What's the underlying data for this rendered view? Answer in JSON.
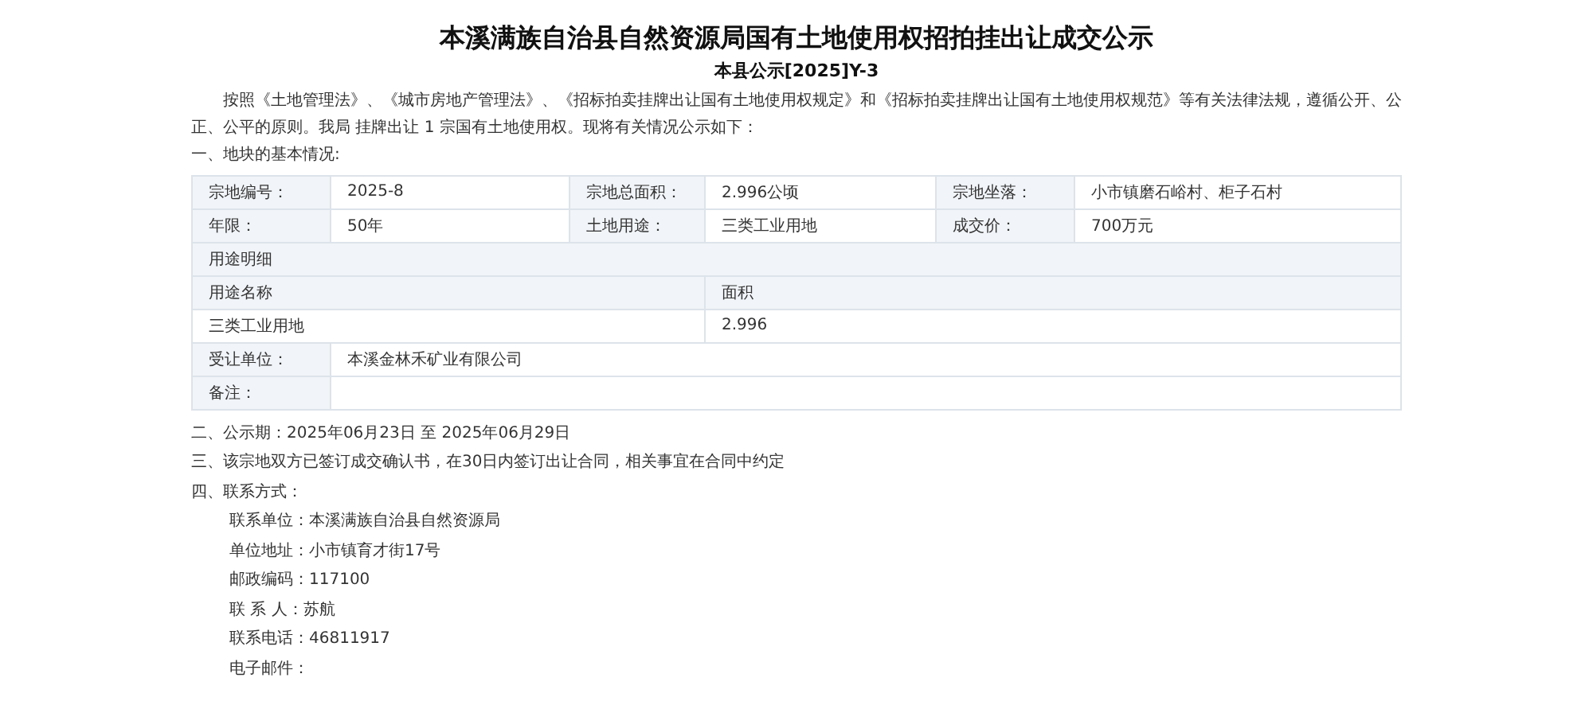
{
  "title": "本溪满族自治县自然资源局国有土地使用权招拍挂出让成交公示",
  "subtitle": "本县公示[2025]Y-3",
  "intro": "按照《土地管理法》、《城市房地产管理法》、《招标拍卖挂牌出让国有土地使用权规定》和《招标拍卖挂牌出让国有土地使用权规范》等有关法律法规，遵循公开、公正、公平的原则。我局 挂牌出让 1 宗国有土地使用权。现将有关情况公示如下：",
  "section_1": "一、地块的基本情况:",
  "info_rows": [
    [
      {
        "label": "宗地编号：",
        "value": "2025-8"
      },
      {
        "label": "宗地总面积：",
        "value": "2.996公顷"
      },
      {
        "label": "宗地坐落：",
        "value": "小市镇磨石峪村、柜子石村"
      }
    ],
    [
      {
        "label": "年限：",
        "value": "50年"
      },
      {
        "label": "土地用途：",
        "value": "三类工业用地"
      },
      {
        "label": "成交价：",
        "value": "700万元"
      }
    ]
  ],
  "usage_detail": {
    "heading": "用途明细",
    "columns": [
      "用途名称",
      "面积"
    ],
    "rows": [
      [
        "三类工业用地",
        "2.996"
      ]
    ]
  },
  "extra_rows": [
    {
      "label": "受让单位：",
      "value": "本溪金林禾矿业有限公司"
    },
    {
      "label": "备注：",
      "value": ""
    }
  ],
  "sections": [
    "二、公示期：2025年06月23日 至 2025年06月29日",
    "三、该宗地双方已签订成交确认书，在30日内签订出让合同，相关事宜在合同中约定",
    "四、联系方式："
  ],
  "contacts": [
    "联系单位：本溪满族自治县自然资源局",
    "单位地址：小市镇育才街17号",
    "邮政编码：117100",
    "联 系 人：苏航",
    "联系电话：46811917",
    "电子邮件："
  ]
}
